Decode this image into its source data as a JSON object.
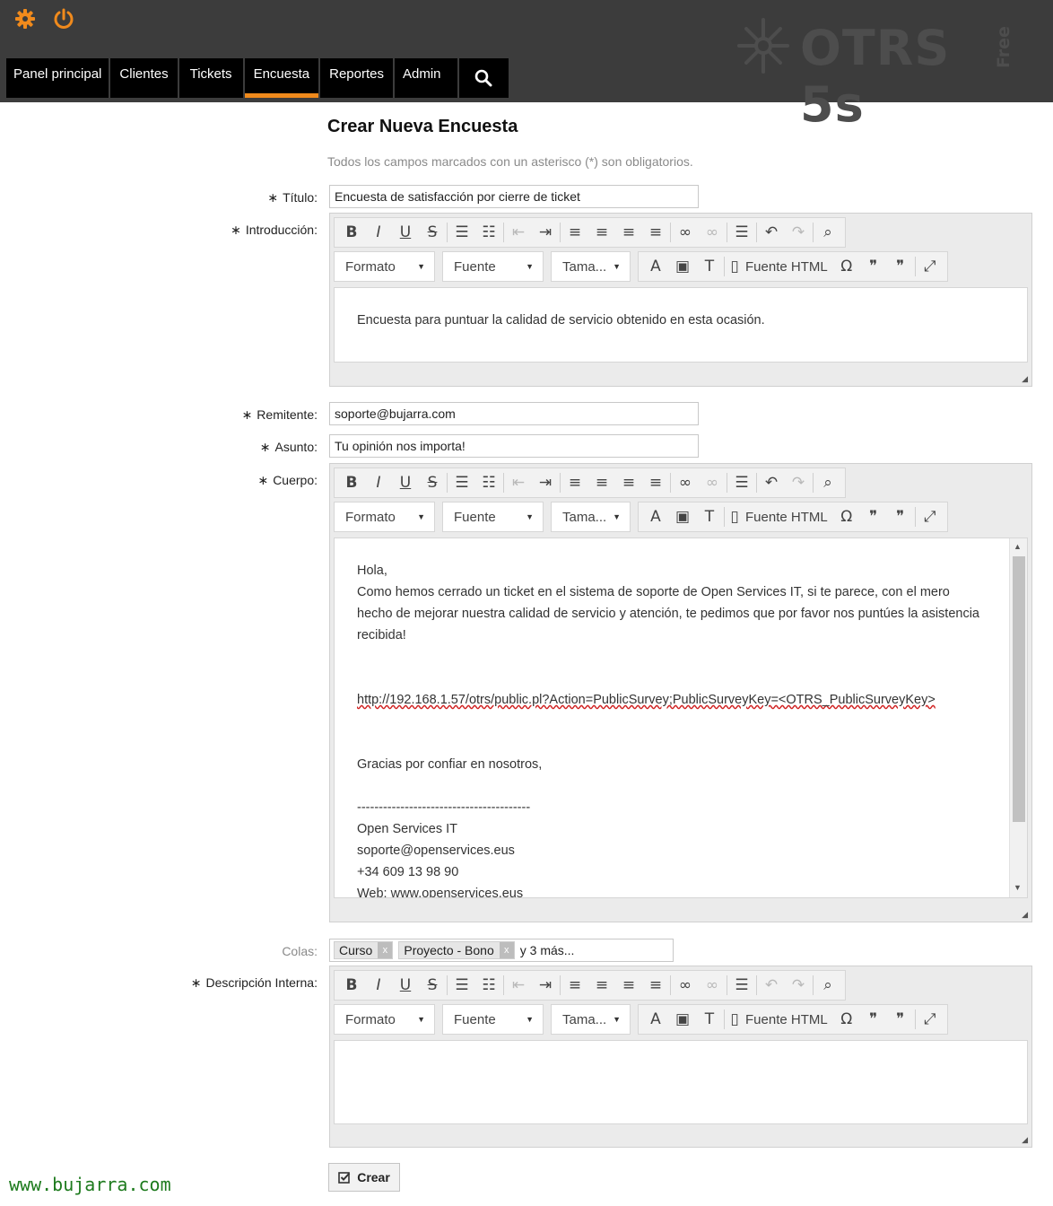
{
  "header": {
    "icons": {
      "settings": "gear-icon",
      "logout": "power-icon",
      "search": "search-icon"
    },
    "logo": {
      "text": "OTRS 5s",
      "edition": "Free"
    },
    "nav": [
      {
        "label": "Panel principal"
      },
      {
        "label": "Clientes"
      },
      {
        "label": "Tickets"
      },
      {
        "label": "Encuesta"
      },
      {
        "label": "Reportes"
      },
      {
        "label": "Admin"
      }
    ],
    "active_tab": "Encuesta",
    "accent": "#f08a1c"
  },
  "page": {
    "title": "Crear Nueva Encuesta",
    "hint": "Todos los campos marcados con un asterisco (*) son obligatorios."
  },
  "form": {
    "required_mark": "∗",
    "titulo": {
      "label": "Título:",
      "value": "Encuesta de satisfacción por cierre de ticket"
    },
    "introduccion": {
      "label": "Introducción:",
      "text": "Encuesta para puntuar la calidad de servicio obtenido en esta ocasión."
    },
    "remitente": {
      "label": "Remitente:",
      "value": "soporte@bujarra.com"
    },
    "asunto": {
      "label": "Asunto:",
      "value": "Tu opinión nos importa!"
    },
    "cuerpo": {
      "label": "Cuerpo:",
      "lines": [
        "Hola,",
        "Como hemos cerrado un ticket en el sistema de soporte de Open Services IT, si te parece, con el mero",
        "hecho de mejorar nuestra calidad de servicio y atención, te pedimos que por favor nos puntúes la asistencia",
        "recibida!",
        "",
        "",
        "http://192.168.1.57/otrs/public.pl?Action=PublicSurvey;PublicSurveyKey=<OTRS_PublicSurveyKey>",
        "",
        "",
        "Gracias por confiar en nosotros,",
        "",
        "----------------------------------------",
        "Open Services IT",
        "soporte@openservices.eus",
        "+34 609 13 98 90",
        "Web: www.openservices.eus"
      ]
    },
    "colas": {
      "label": "Colas:",
      "tags": [
        "Curso",
        "Proyecto - Bono"
      ],
      "tag_remove": "x",
      "more": "y 3 más..."
    },
    "descripcion": {
      "label": "Descripción Interna:"
    },
    "submit_label": "Crear"
  },
  "editor_toolbar": {
    "buttons": [
      "B",
      "I",
      "U",
      "S"
    ],
    "format_label": "Formato",
    "font_label": "Fuente",
    "size_label": "Tama...",
    "source_label": "Fuente HTML"
  },
  "watermark": "www.bujarra.com"
}
